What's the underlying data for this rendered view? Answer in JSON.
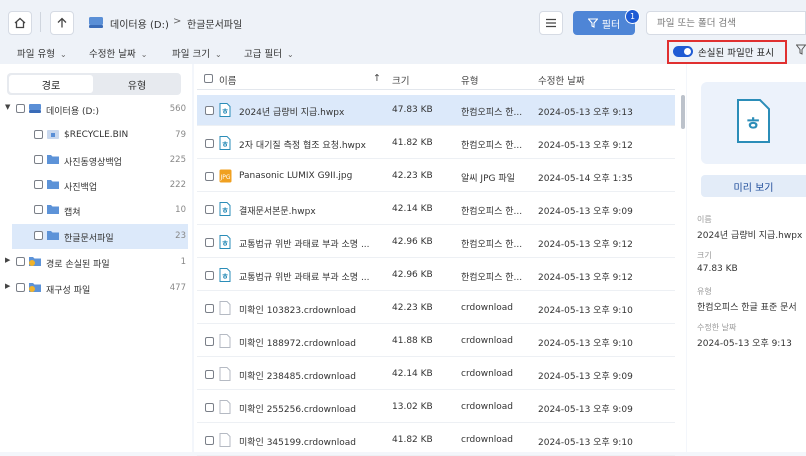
{
  "header": {
    "drive_label": "데이터용 (D:)",
    "separator": ">",
    "current_folder": "한글문서파일",
    "filter_label": "필터",
    "filter_badge": "1",
    "search_placeholder": "파일 또는 폴더 검색"
  },
  "filter_bar": {
    "items": [
      "파일 유형",
      "수정한 날짜",
      "파일 크기",
      "고급 필터"
    ],
    "toggle_label": "손실된 파일만 표시",
    "toggle_on": true
  },
  "left_panel": {
    "tabs": [
      "경로",
      "유형"
    ],
    "tree": [
      {
        "label": "데이터용 (D:)",
        "count": "560"
      },
      {
        "label": "$RECYCLE.BIN",
        "count": "79"
      },
      {
        "label": "사진동영상백업",
        "count": "225"
      },
      {
        "label": "사진백업",
        "count": "222"
      },
      {
        "label": "캡쳐",
        "count": "10"
      },
      {
        "label": "한글문서파일",
        "count": "23"
      },
      {
        "label": "경로 손실된 파일",
        "count": "1"
      },
      {
        "label": "재구성 파일",
        "count": "477"
      }
    ]
  },
  "file_list": {
    "columns": [
      "이름",
      "크기",
      "유형",
      "수정한 날짜"
    ],
    "sort_arrow": "↑",
    "rows": [
      {
        "name": "2024년 급량비 지급.hwpx",
        "size": "47.83 KB",
        "type": "한컴오피스 한...",
        "date": "2024-05-13 오후 9:13"
      },
      {
        "name": "2자 대기질 측정 협조 요청.hwpx",
        "size": "41.82 KB",
        "type": "한컴오피스 한...",
        "date": "2024-05-13 오후 9:12"
      },
      {
        "name": "Panasonic LUMIX G9II.jpg",
        "size": "42.23 KB",
        "type": "알씨 JPG 파일",
        "date": "2024-05-14 오후 1:35"
      },
      {
        "name": "결재문서본문.hwpx",
        "size": "42.14 KB",
        "type": "한컴오피스 한...",
        "date": "2024-05-13 오후 9:09"
      },
      {
        "name": "교통법규 위반 과태료 부과 소명 ...",
        "size": "42.96 KB",
        "type": "한컴오피스 한...",
        "date": "2024-05-13 오후 9:12"
      },
      {
        "name": "교통법규 위반 과태료 부과 소명 ...",
        "size": "42.96 KB",
        "type": "한컴오피스 한...",
        "date": "2024-05-13 오후 9:12"
      },
      {
        "name": "미확인 103823.crdownload",
        "size": "42.23 KB",
        "type": "crdownload",
        "date": "2024-05-13 오후 9:10"
      },
      {
        "name": "미확인 188972.crdownload",
        "size": "41.88 KB",
        "type": "crdownload",
        "date": "2024-05-13 오후 9:10"
      },
      {
        "name": "미확인 238485.crdownload",
        "size": "42.14 KB",
        "type": "crdownload",
        "date": "2024-05-13 오후 9:09"
      },
      {
        "name": "미확인 255256.crdownload",
        "size": "13.02 KB",
        "type": "crdownload",
        "date": "2024-05-13 오후 9:09"
      },
      {
        "name": "미확인 345199.crdownload",
        "size": "41.82 KB",
        "type": "crdownload",
        "date": "2024-05-13 오후 9:10"
      }
    ]
  },
  "details": {
    "preview_button": "미리 보기",
    "name_label": "이름",
    "name_value": "2024년 급량비 지급.hwpx",
    "size_label": "크기",
    "size_value": "47.83 KB",
    "type_label": "유형",
    "type_value": "한컴오피스 한글 표준 문서",
    "date_label": "수정한 날짜",
    "date_value": "2024-05-13 오후 9:13"
  },
  "colors": {
    "accent": "#4e85d6",
    "selection": "#dce9fa",
    "highlight_border": "#e03030"
  }
}
